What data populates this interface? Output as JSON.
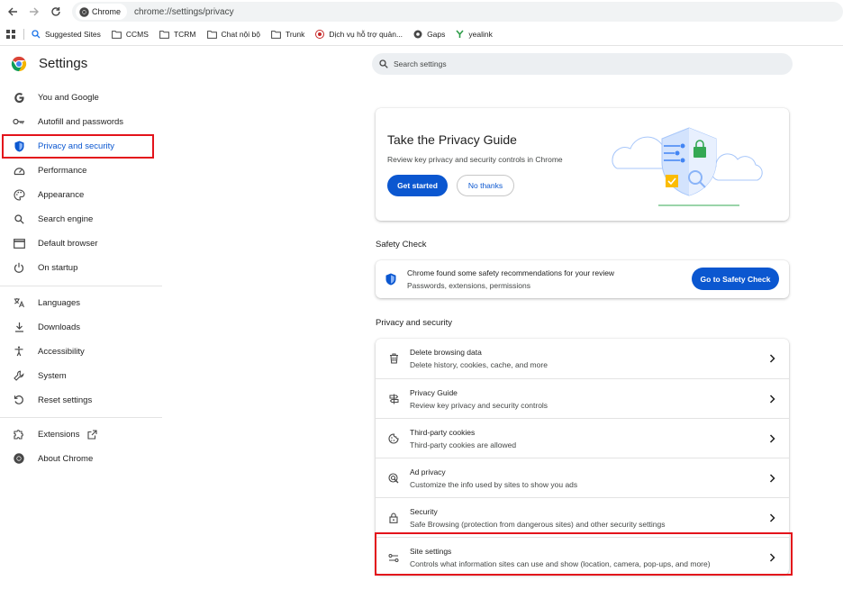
{
  "browser": {
    "chip_label": "Chrome",
    "url": "chrome://settings/privacy"
  },
  "bookmarks": [
    {
      "label": "Suggested Sites",
      "icon": "suggested-sites-icon"
    },
    {
      "label": "CCMS",
      "icon": "folder-icon"
    },
    {
      "label": "TCRM",
      "icon": "folder-icon"
    },
    {
      "label": "Chat nội bộ",
      "icon": "folder-icon"
    },
    {
      "label": "Trunk",
      "icon": "folder-icon"
    },
    {
      "label": "Dịch vụ hỗ trợ quản...",
      "icon": "site-favicon-icon"
    },
    {
      "label": "Gaps",
      "icon": "gaps-favicon-icon"
    },
    {
      "label": "yealink",
      "icon": "yealink-favicon-icon"
    }
  ],
  "header": {
    "title": "Settings",
    "search_placeholder": "Search settings"
  },
  "sidebar": {
    "items": [
      {
        "label": "You and Google",
        "icon": "google-icon"
      },
      {
        "label": "Autofill and passwords",
        "icon": "key-icon"
      },
      {
        "label": "Privacy and security",
        "icon": "shield-icon",
        "active": true
      },
      {
        "label": "Performance",
        "icon": "speedometer-icon"
      },
      {
        "label": "Appearance",
        "icon": "palette-icon"
      },
      {
        "label": "Search engine",
        "icon": "search-icon"
      },
      {
        "label": "Default browser",
        "icon": "browser-window-icon"
      },
      {
        "label": "On startup",
        "icon": "power-icon"
      },
      {
        "label": "Languages",
        "icon": "translate-icon"
      },
      {
        "label": "Downloads",
        "icon": "download-icon"
      },
      {
        "label": "Accessibility",
        "icon": "accessibility-icon"
      },
      {
        "label": "System",
        "icon": "wrench-icon"
      },
      {
        "label": "Reset settings",
        "icon": "reset-icon"
      },
      {
        "label": "Extensions",
        "icon": "puzzle-icon"
      },
      {
        "label": "About Chrome",
        "icon": "chrome-icon"
      }
    ]
  },
  "privacy_guide": {
    "title": "Take the Privacy Guide",
    "description": "Review key privacy and security controls in Chrome",
    "primary_button": "Get started",
    "secondary_button": "No thanks"
  },
  "safety_check": {
    "section_label": "Safety Check",
    "title": "Chrome found some safety recommendations for your review",
    "subtitle": "Passwords, extensions, permissions",
    "button": "Go to Safety Check"
  },
  "privacy_security": {
    "section_label": "Privacy and security",
    "rows": [
      {
        "title": "Delete browsing data",
        "subtitle": "Delete history, cookies, cache, and more",
        "icon": "trash-icon"
      },
      {
        "title": "Privacy Guide",
        "subtitle": "Review key privacy and security controls",
        "icon": "signpost-icon"
      },
      {
        "title": "Third-party cookies",
        "subtitle": "Third-party cookies are allowed",
        "icon": "cookie-icon"
      },
      {
        "title": "Ad privacy",
        "subtitle": "Customize the info used by sites to show you ads",
        "icon": "ad-privacy-icon"
      },
      {
        "title": "Security",
        "subtitle": "Safe Browsing (protection from dangerous sites) and other security settings",
        "icon": "lock-icon"
      },
      {
        "title": "Site settings",
        "subtitle": "Controls what information sites can use and show (location, camera, pop-ups, and more)",
        "icon": "sliders-icon"
      }
    ]
  },
  "colors": {
    "accent": "#0b57d0",
    "highlight_box": "#e3131b",
    "text_primary": "#1f1f1f",
    "text_secondary": "#444746"
  }
}
